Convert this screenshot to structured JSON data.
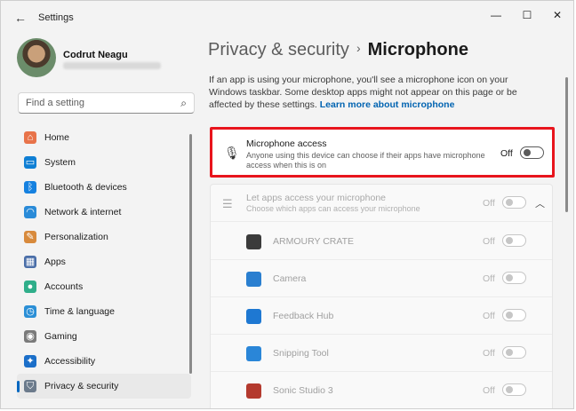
{
  "window": {
    "title": "Settings"
  },
  "user": {
    "name": "Codrut Neagu"
  },
  "search": {
    "placeholder": "Find a setting"
  },
  "nav": [
    {
      "label": "Home",
      "icon": "home-icon",
      "color": "#e8734a"
    },
    {
      "label": "System",
      "icon": "monitor-icon",
      "color": "#0f7fd4"
    },
    {
      "label": "Bluetooth & devices",
      "icon": "bluetooth-icon",
      "color": "#1581e0"
    },
    {
      "label": "Network & internet",
      "icon": "wifi-icon",
      "color": "#2a8bd8"
    },
    {
      "label": "Personalization",
      "icon": "brush-icon",
      "color": "#d88a3c"
    },
    {
      "label": "Apps",
      "icon": "apps-icon",
      "color": "#4a6ea8"
    },
    {
      "label": "Accounts",
      "icon": "person-icon",
      "color": "#2fae8a"
    },
    {
      "label": "Time & language",
      "icon": "globe-clock-icon",
      "color": "#2b8fd6"
    },
    {
      "label": "Gaming",
      "icon": "gamepad-icon",
      "color": "#7a7a7a"
    },
    {
      "label": "Accessibility",
      "icon": "accessibility-icon",
      "color": "#1b6fc9"
    },
    {
      "label": "Privacy & security",
      "icon": "shield-icon",
      "color": "#6c7b8c",
      "active": true
    }
  ],
  "page": {
    "breadcrumb_parent": "Privacy & security",
    "breadcrumb_sep": "›",
    "title": "Microphone",
    "intro": "If an app is using your microphone, you'll see a microphone icon on your Windows taskbar. Some desktop apps might not appear on this page or be affected by these settings.",
    "learn_more": "Learn more about microphone"
  },
  "mic_access": {
    "title": "Microphone access",
    "description": "Anyone using this device can choose if their apps have microphone access when this is on",
    "state": "Off"
  },
  "apps_access": {
    "title": "Let apps access your microphone",
    "description": "Choose which apps can access your microphone",
    "state": "Off"
  },
  "apps": [
    {
      "name": "ARMOURY CRATE",
      "state": "Off",
      "icon_color": "#3b3b3b"
    },
    {
      "name": "Camera",
      "state": "Off",
      "icon_color": "#2a7fd0"
    },
    {
      "name": "Feedback Hub",
      "state": "Off",
      "icon_color": "#1e78d2"
    },
    {
      "name": "Snipping Tool",
      "state": "Off",
      "icon_color": "#2a86d8"
    },
    {
      "name": "Sonic Studio 3",
      "state": "Off",
      "icon_color": "#b43a2e"
    }
  ]
}
